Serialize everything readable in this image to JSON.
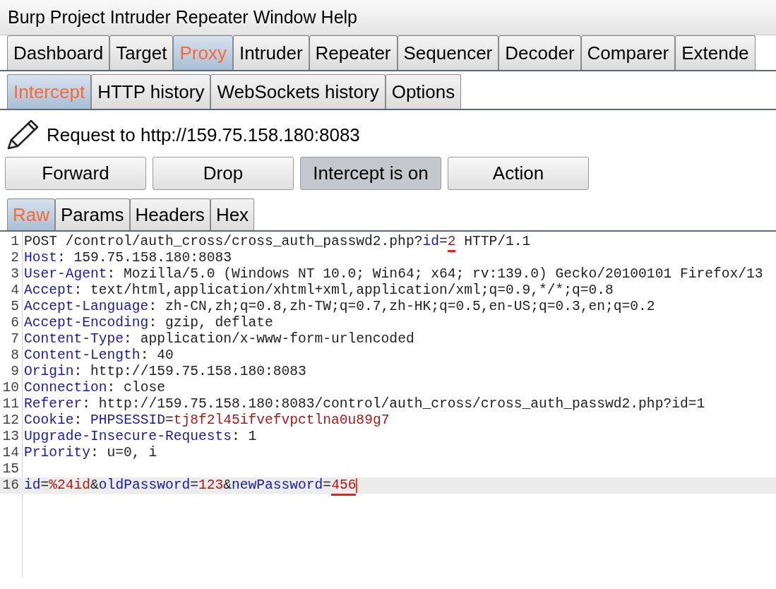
{
  "menu_bar": [
    "Burp",
    "Project",
    "Intruder",
    "Repeater",
    "Window",
    "Help"
  ],
  "main_tabs": [
    {
      "label": "Dashboard",
      "selected": false
    },
    {
      "label": "Target",
      "selected": false
    },
    {
      "label": "Proxy",
      "selected": true
    },
    {
      "label": "Intruder",
      "selected": false
    },
    {
      "label": "Repeater",
      "selected": false
    },
    {
      "label": "Sequencer",
      "selected": false
    },
    {
      "label": "Decoder",
      "selected": false
    },
    {
      "label": "Comparer",
      "selected": false
    },
    {
      "label": "Extende",
      "selected": false
    }
  ],
  "proxy_tabs": [
    {
      "label": "Intercept",
      "selected": true
    },
    {
      "label": "HTTP history",
      "selected": false
    },
    {
      "label": "WebSockets history",
      "selected": false
    },
    {
      "label": "Options",
      "selected": false
    }
  ],
  "request_title": "Request to http://159.75.158.180:8083",
  "buttons": [
    {
      "label": "Forward",
      "pressed": false
    },
    {
      "label": "Drop",
      "pressed": false
    },
    {
      "label": "Intercept is on",
      "pressed": true
    },
    {
      "label": "Action",
      "pressed": false
    }
  ],
  "message_tabs": [
    {
      "label": "Raw",
      "selected": true
    },
    {
      "label": "Params",
      "selected": false
    },
    {
      "label": "Headers",
      "selected": false
    },
    {
      "label": "Hex",
      "selected": false
    }
  ],
  "editor": {
    "lines": [
      {
        "number": "1",
        "current": false,
        "segments": [
          {
            "kind": "plain",
            "text": "POST /control/auth_cross/cross_auth_passwd2.php?"
          },
          {
            "kind": "name",
            "text": "id"
          },
          {
            "kind": "plain",
            "text": "="
          },
          {
            "kind": "value",
            "text": "2",
            "annotated": true
          },
          {
            "kind": "plain",
            "text": " HTTP/1.1"
          }
        ]
      },
      {
        "number": "2",
        "current": false,
        "segments": [
          {
            "kind": "name",
            "text": "Host"
          },
          {
            "kind": "plain",
            "text": ": 159.75.158.180:8083"
          }
        ]
      },
      {
        "number": "3",
        "current": false,
        "segments": [
          {
            "kind": "name",
            "text": "User-Agent"
          },
          {
            "kind": "plain",
            "text": ": Mozilla/5.0 (Windows NT 10.0; Win64; x64; rv:139.0) Gecko/20100101 Firefox/13"
          }
        ]
      },
      {
        "number": "4",
        "current": false,
        "segments": [
          {
            "kind": "name",
            "text": "Accept"
          },
          {
            "kind": "plain",
            "text": ": text/html,application/xhtml+xml,application/xml;q=0.9,*/*;q=0.8"
          }
        ]
      },
      {
        "number": "5",
        "current": false,
        "segments": [
          {
            "kind": "name",
            "text": "Accept-Language"
          },
          {
            "kind": "plain",
            "text": ": zh-CN,zh;q=0.8,zh-TW;q=0.7,zh-HK;q=0.5,en-US;q=0.3,en;q=0.2"
          }
        ]
      },
      {
        "number": "6",
        "current": false,
        "segments": [
          {
            "kind": "name",
            "text": "Accept-Encoding"
          },
          {
            "kind": "plain",
            "text": ": gzip, deflate"
          }
        ]
      },
      {
        "number": "7",
        "current": false,
        "segments": [
          {
            "kind": "name",
            "text": "Content-Type"
          },
          {
            "kind": "plain",
            "text": ": application/x-www-form-urlencoded"
          }
        ]
      },
      {
        "number": "8",
        "current": false,
        "segments": [
          {
            "kind": "name",
            "text": "Content-Length"
          },
          {
            "kind": "plain",
            "text": ": 40"
          }
        ]
      },
      {
        "number": "9",
        "current": false,
        "segments": [
          {
            "kind": "name",
            "text": "Origin"
          },
          {
            "kind": "plain",
            "text": ": http://159.75.158.180:8083"
          }
        ]
      },
      {
        "number": "10",
        "current": false,
        "segments": [
          {
            "kind": "name",
            "text": "Connection"
          },
          {
            "kind": "plain",
            "text": ": close"
          }
        ]
      },
      {
        "number": "11",
        "current": false,
        "segments": [
          {
            "kind": "name",
            "text": "Referer"
          },
          {
            "kind": "plain",
            "text": ": http://159.75.158.180:8083/control/auth_cross/cross_auth_passwd2.php?id=1"
          }
        ]
      },
      {
        "number": "12",
        "current": false,
        "segments": [
          {
            "kind": "name",
            "text": "Cookie"
          },
          {
            "kind": "plain",
            "text": ": "
          },
          {
            "kind": "name",
            "text": "PHPSESSID"
          },
          {
            "kind": "plain",
            "text": "="
          },
          {
            "kind": "value",
            "text": "tj8f2l45ifvefvpctlna0u89g7"
          }
        ]
      },
      {
        "number": "13",
        "current": false,
        "segments": [
          {
            "kind": "name",
            "text": "Upgrade-Insecure-Requests"
          },
          {
            "kind": "plain",
            "text": ": 1"
          }
        ]
      },
      {
        "number": "14",
        "current": false,
        "segments": [
          {
            "kind": "name",
            "text": "Priority"
          },
          {
            "kind": "plain",
            "text": ": u=0, i"
          }
        ]
      },
      {
        "number": "15",
        "current": false
      },
      {
        "number": "16",
        "current": true,
        "segments": [
          {
            "kind": "name",
            "text": "id"
          },
          {
            "kind": "plain",
            "text": "="
          },
          {
            "kind": "value",
            "text": "%24id"
          },
          {
            "kind": "plain",
            "text": "&"
          },
          {
            "kind": "name",
            "text": "oldPassword"
          },
          {
            "kind": "plain",
            "text": "="
          },
          {
            "kind": "value",
            "text": "123"
          },
          {
            "kind": "plain",
            "text": "&"
          },
          {
            "kind": "name",
            "text": "newPassword"
          },
          {
            "kind": "plain",
            "text": "="
          },
          {
            "kind": "value",
            "text": "456",
            "annotated": true
          }
        ]
      }
    ]
  }
}
